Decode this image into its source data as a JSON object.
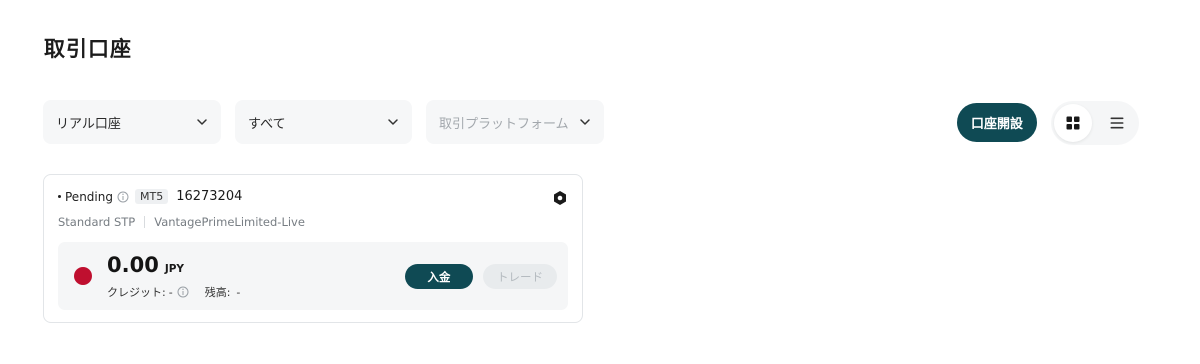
{
  "page": {
    "title": "取引口座"
  },
  "filters": [
    {
      "label": "リアル口座",
      "disabled": false
    },
    {
      "label": "すべて",
      "disabled": false
    },
    {
      "label": "取引プラットフォーム",
      "disabled": true
    }
  ],
  "toolbar": {
    "open_account_label": "口座開設",
    "view_options": [
      {
        "icon": "grid-view-icon",
        "active": true
      },
      {
        "icon": "list-view-icon",
        "active": false
      }
    ]
  },
  "account_card": {
    "status": "Pending",
    "platform": "MT5",
    "account_number": "16273204",
    "account_type": "Standard STP",
    "server": "VantagePrimeLimited-Live",
    "balance": {
      "amount": "0.00",
      "currency": "JPY",
      "credit_label": "クレジット:",
      "credit_value": "-",
      "balance_label": "残高:",
      "balance_value": "-"
    },
    "deposit_label": "入金",
    "trade_label": "トレード",
    "flag_color": "#bf0f2f"
  },
  "colors": {
    "accent": "#0f4a54"
  }
}
